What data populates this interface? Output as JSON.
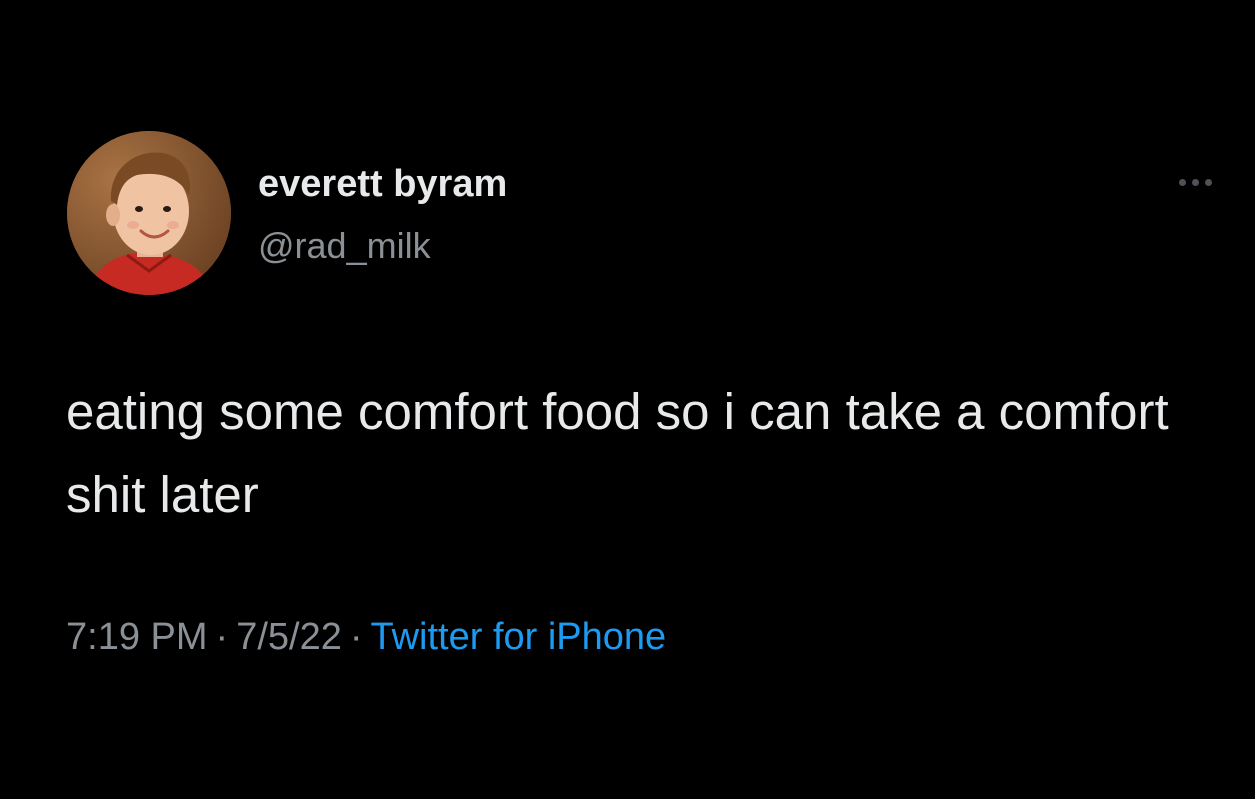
{
  "author": {
    "display_name": "everett byram",
    "handle": "@rad_milk",
    "avatar_icon": "profile-photo-child"
  },
  "tweet": {
    "text": "eating some comfort food so i can take a comfort shit later",
    "time": "7:19 PM",
    "date": "7/5/22",
    "separator": "·",
    "source": "Twitter for iPhone"
  },
  "colors": {
    "background": "#000000",
    "primary_text": "#e7e9ea",
    "secondary_text": "#8b9096",
    "link": "#1d9bf0"
  }
}
